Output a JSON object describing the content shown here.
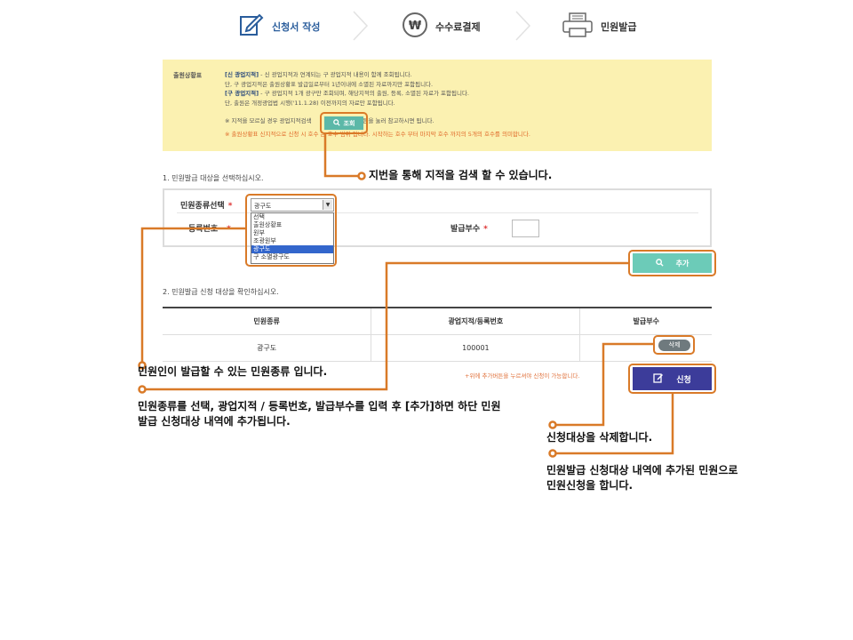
{
  "steps": [
    {
      "label": "신청서 작성",
      "icon": "form-edit-icon",
      "active": true
    },
    {
      "label": "수수료결제",
      "icon": "won-coin-icon",
      "active": false
    },
    {
      "label": "민원발급",
      "icon": "printer-icon",
      "active": false
    }
  ],
  "notice": {
    "title": "출원상황표",
    "line1_bold": "[신 광업지적]",
    "line1": " - 신 광업지적과 연계되는 구 광업지적 내용이 함께 조회됩니다.",
    "line2": "단, 구 광업지적은 출원상황표 발급일로부터 1년이내에 소멸된 자료까지만 포함됩니다.",
    "line3_bold": "[구 광업지적]",
    "line3": " - 구 광업지적 1개 광구만 조회되며, 해당지적의 출원, 등록, 소멸된 자료가 포함됩니다.",
    "line4": "단, 출원은 개정광업법 시행('11.1.28) 이전까지의 자료만 포함됩니다.",
    "line5a": "※ 지적을 모르실 경우 광업지적검색",
    "line5b": " 버튼을 눌러 참고하시면 됩니다.",
    "line6a": "※ 출원상황표 신지적으로 신청 시 ",
    "line6b": "호수 는 호수 범위 입니다. 시작하는 호수 부터 마지막 호수 까지의 5개의 호수를 의미합니다.",
    "search_button": "조회"
  },
  "form": {
    "section1": "1. 민원발급 대상을 선택하십시오.",
    "type_label": "민원종류선택",
    "reg_label": "등록번호",
    "qty_label": "발급부수",
    "required_mark": "*",
    "selected_value": "광구도",
    "options": [
      "선택",
      "출원상황표",
      "원부",
      "조광원부",
      "광구도",
      "구 소멸광구도"
    ],
    "selected_index": 4,
    "add_button": "추가"
  },
  "list": {
    "section2": "2. 민원발급 신청 대상을 확인하십시오.",
    "headers": [
      "민원종류",
      "광업지적/등록번호",
      "발급부수"
    ],
    "rows": [
      {
        "type": "광구도",
        "number": "100001",
        "delete": "삭제"
      }
    ],
    "hint": "+위에 추가버튼을 누르셔야 신청이 가능합니다.",
    "apply_button": "신청"
  },
  "annotations": {
    "a1": "지번을 통해 지적을 검색 할 수 있습니다.",
    "a2": "민원인이 발급할 수 있는 민원종류 입니다.",
    "a3_line1": "민원종류를 선택, 광업지적 / 등록번호, 발급부수를 입력 후 [추가]하면 하단 민원",
    "a3_line2": "발급 신청대상 내역에 추가됩니다.",
    "a4": "신청대상을 삭제합니다.",
    "a5_line1": "민원발급 신청대상 내역에 추가된 민원으로",
    "a5_line2": "민원신청을 합니다."
  },
  "colors": {
    "accent_orange": "#d97a28",
    "notice_bg": "#fbf1b1",
    "add_button": "#6ccbb8",
    "apply_button": "#3c3c9a",
    "active_step": "#2a5d9c"
  }
}
